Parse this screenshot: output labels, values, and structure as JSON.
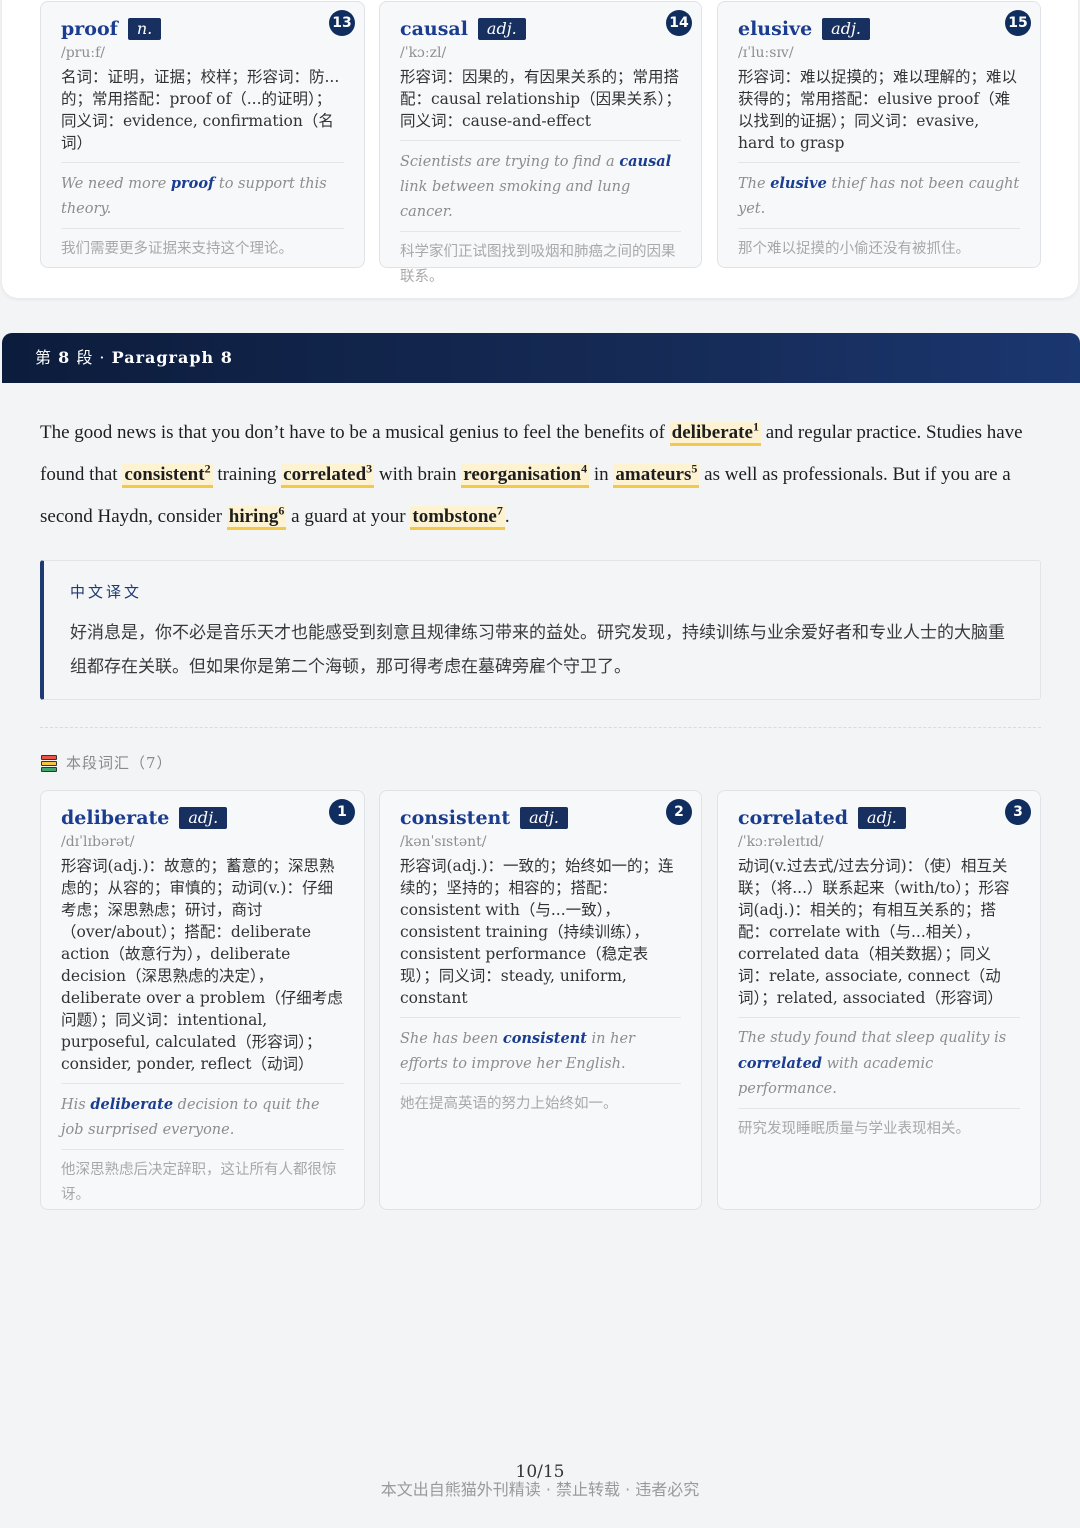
{
  "top_cards": [
    {
      "word": "proof",
      "pos": "n.",
      "num": "13",
      "phonetic": "/pruːf/",
      "definition": "名词：证明，证据；校样；形容词：防...的；常用搭配：proof of（...的证明）；同义词：evidence, confirmation（名词）",
      "ex_pre": "We need more ",
      "ex_word": "proof",
      "ex_post": " to support this theory.",
      "ex_zh": "我们需要更多证据来支持这个理论。"
    },
    {
      "word": "causal",
      "pos": "adj.",
      "num": "14",
      "phonetic": "/ˈkɔːzl/",
      "definition": "形容词：因果的，有因果关系的；常用搭配：causal relationship（因果关系）；同义词：cause-and-effect",
      "ex_pre": "Scientists are trying to find a ",
      "ex_word": "causal",
      "ex_post": " link between smoking and lung cancer.",
      "ex_zh": "科学家们正试图找到吸烟和肺癌之间的因果联系。"
    },
    {
      "word": "elusive",
      "pos": "adj.",
      "num": "15",
      "phonetic": "/ɪˈluːsɪv/",
      "definition": "形容词：难以捉摸的；难以理解的；难以获得的；常用搭配：elusive proof（难以找到的证据）；同义词：evasive, hard to grasp",
      "ex_pre": "The ",
      "ex_word": "elusive",
      "ex_post": " thief has not been caught yet.",
      "ex_zh": "那个难以捉摸的小偷还没有被抓住。"
    }
  ],
  "banner": {
    "prefix": "第 ",
    "number": "8",
    "middle": " 段 · ",
    "title": "Paragraph 8"
  },
  "paragraph": {
    "t1": "The good news is that you don’t have to be a musical genius to feel the benefits of ",
    "w1": "deliberate",
    "s1": "1",
    "t2": " and regular practice. Studies have found that ",
    "w2": "consistent",
    "s2": "2",
    "t3": " training ",
    "w3": "correlated",
    "s3": "3",
    "t4": " with brain ",
    "w4": "reorganisation",
    "s4": "4",
    "t5": " in ",
    "w5": "amateurs",
    "s5": "5",
    "t6": " as well as professionals. But if you are a second Haydn, consider ",
    "w6": "hiring",
    "s6": "6",
    "t7": " a guard at your ",
    "w7": "tombstone",
    "s7": "7",
    "t8": "."
  },
  "translation": {
    "title": "中文译文",
    "text": "好消息是，你不必是音乐天才也能感受到刻意且规律练习带来的益处。研究发现，持续训练与业余爱好者和专业人士的大脑重组都存在关联。但如果你是第二个海顿，那可得考虑在墓碑旁雇个守卫了。"
  },
  "vocab_label": "本段词汇（7）",
  "bottom_cards": [
    {
      "word": "deliberate",
      "pos": "adj.",
      "num": "1",
      "phonetic": "/dɪˈlɪbərət/",
      "definition": "形容词(adj.)：故意的；蓄意的；深思熟虑的；从容的；审慎的；动词(v.)：仔细考虑；深思熟虑；研讨，商讨（over/about）；搭配：deliberate action（故意行为），deliberate decision（深思熟虑的决定），deliberate over a problem（仔细考虑问题）；同义词：intentional, purposeful, calculated（形容词）；consider, ponder, reflect（动词）",
      "ex_pre": "His ",
      "ex_word": "deliberate",
      "ex_post": " decision to quit the job surprised everyone.",
      "ex_zh": "他深思熟虑后决定辞职，这让所有人都很惊讶。"
    },
    {
      "word": "consistent",
      "pos": "adj.",
      "num": "2",
      "phonetic": "/kənˈsɪstənt/",
      "definition": "形容词(adj.)：一致的；始终如一的；连续的；坚持的；相容的；搭配：consistent with（与...一致），consistent training（持续训练），consistent performance（稳定表现）；同义词：steady, uniform, constant",
      "ex_pre": "She has been ",
      "ex_word": "consistent",
      "ex_post": " in her efforts to improve her English.",
      "ex_zh": "她在提高英语的努力上始终如一。"
    },
    {
      "word": "correlated",
      "pos": "adj.",
      "num": "3",
      "phonetic": "/ˈkɔːrəleɪtɪd/",
      "definition": "动词(v.过去式/过去分词)：（使）相互关联；（将...）联系起来（with/to）；形容词(adj.)：相关的；有相互关系的；搭配：correlate with（与...相关），correlated data（相关数据）；同义词：relate, associate, connect（动词）；related, associated（形容词）",
      "ex_pre": "The study found that sleep quality is ",
      "ex_word": "correlated",
      "ex_post": " with academic performance.",
      "ex_zh": "研究发现睡眠质量与学业表现相关。"
    }
  ],
  "footer": {
    "page": "10/15",
    "note": "本文出自熊猫外刊精读 · 禁止转载 · 违者必究"
  }
}
